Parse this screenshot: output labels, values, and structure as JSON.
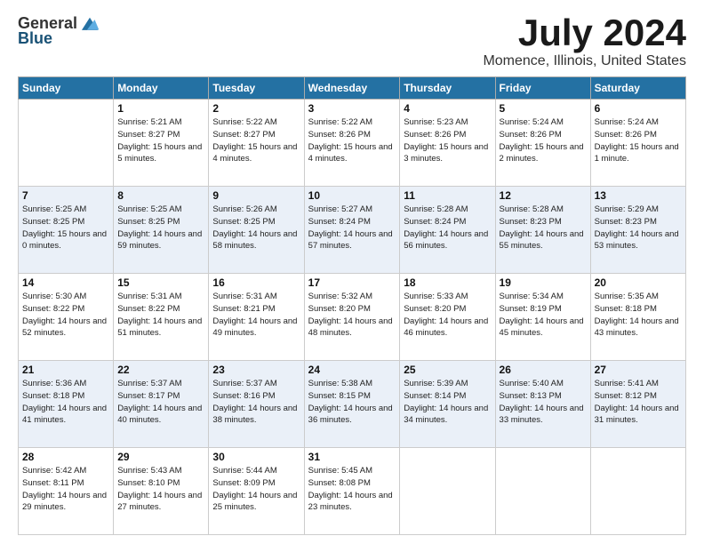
{
  "logo": {
    "general": "General",
    "blue": "Blue"
  },
  "title": "July 2024",
  "location": "Momence, Illinois, United States",
  "headers": [
    "Sunday",
    "Monday",
    "Tuesday",
    "Wednesday",
    "Thursday",
    "Friday",
    "Saturday"
  ],
  "weeks": [
    [
      {
        "day": "",
        "sunrise": "",
        "sunset": "",
        "daylight": ""
      },
      {
        "day": "1",
        "sunrise": "Sunrise: 5:21 AM",
        "sunset": "Sunset: 8:27 PM",
        "daylight": "Daylight: 15 hours and 5 minutes."
      },
      {
        "day": "2",
        "sunrise": "Sunrise: 5:22 AM",
        "sunset": "Sunset: 8:27 PM",
        "daylight": "Daylight: 15 hours and 4 minutes."
      },
      {
        "day": "3",
        "sunrise": "Sunrise: 5:22 AM",
        "sunset": "Sunset: 8:26 PM",
        "daylight": "Daylight: 15 hours and 4 minutes."
      },
      {
        "day": "4",
        "sunrise": "Sunrise: 5:23 AM",
        "sunset": "Sunset: 8:26 PM",
        "daylight": "Daylight: 15 hours and 3 minutes."
      },
      {
        "day": "5",
        "sunrise": "Sunrise: 5:24 AM",
        "sunset": "Sunset: 8:26 PM",
        "daylight": "Daylight: 15 hours and 2 minutes."
      },
      {
        "day": "6",
        "sunrise": "Sunrise: 5:24 AM",
        "sunset": "Sunset: 8:26 PM",
        "daylight": "Daylight: 15 hours and 1 minute."
      }
    ],
    [
      {
        "day": "7",
        "sunrise": "Sunrise: 5:25 AM",
        "sunset": "Sunset: 8:25 PM",
        "daylight": "Daylight: 15 hours and 0 minutes."
      },
      {
        "day": "8",
        "sunrise": "Sunrise: 5:25 AM",
        "sunset": "Sunset: 8:25 PM",
        "daylight": "Daylight: 14 hours and 59 minutes."
      },
      {
        "day": "9",
        "sunrise": "Sunrise: 5:26 AM",
        "sunset": "Sunset: 8:25 PM",
        "daylight": "Daylight: 14 hours and 58 minutes."
      },
      {
        "day": "10",
        "sunrise": "Sunrise: 5:27 AM",
        "sunset": "Sunset: 8:24 PM",
        "daylight": "Daylight: 14 hours and 57 minutes."
      },
      {
        "day": "11",
        "sunrise": "Sunrise: 5:28 AM",
        "sunset": "Sunset: 8:24 PM",
        "daylight": "Daylight: 14 hours and 56 minutes."
      },
      {
        "day": "12",
        "sunrise": "Sunrise: 5:28 AM",
        "sunset": "Sunset: 8:23 PM",
        "daylight": "Daylight: 14 hours and 55 minutes."
      },
      {
        "day": "13",
        "sunrise": "Sunrise: 5:29 AM",
        "sunset": "Sunset: 8:23 PM",
        "daylight": "Daylight: 14 hours and 53 minutes."
      }
    ],
    [
      {
        "day": "14",
        "sunrise": "Sunrise: 5:30 AM",
        "sunset": "Sunset: 8:22 PM",
        "daylight": "Daylight: 14 hours and 52 minutes."
      },
      {
        "day": "15",
        "sunrise": "Sunrise: 5:31 AM",
        "sunset": "Sunset: 8:22 PM",
        "daylight": "Daylight: 14 hours and 51 minutes."
      },
      {
        "day": "16",
        "sunrise": "Sunrise: 5:31 AM",
        "sunset": "Sunset: 8:21 PM",
        "daylight": "Daylight: 14 hours and 49 minutes."
      },
      {
        "day": "17",
        "sunrise": "Sunrise: 5:32 AM",
        "sunset": "Sunset: 8:20 PM",
        "daylight": "Daylight: 14 hours and 48 minutes."
      },
      {
        "day": "18",
        "sunrise": "Sunrise: 5:33 AM",
        "sunset": "Sunset: 8:20 PM",
        "daylight": "Daylight: 14 hours and 46 minutes."
      },
      {
        "day": "19",
        "sunrise": "Sunrise: 5:34 AM",
        "sunset": "Sunset: 8:19 PM",
        "daylight": "Daylight: 14 hours and 45 minutes."
      },
      {
        "day": "20",
        "sunrise": "Sunrise: 5:35 AM",
        "sunset": "Sunset: 8:18 PM",
        "daylight": "Daylight: 14 hours and 43 minutes."
      }
    ],
    [
      {
        "day": "21",
        "sunrise": "Sunrise: 5:36 AM",
        "sunset": "Sunset: 8:18 PM",
        "daylight": "Daylight: 14 hours and 41 minutes."
      },
      {
        "day": "22",
        "sunrise": "Sunrise: 5:37 AM",
        "sunset": "Sunset: 8:17 PM",
        "daylight": "Daylight: 14 hours and 40 minutes."
      },
      {
        "day": "23",
        "sunrise": "Sunrise: 5:37 AM",
        "sunset": "Sunset: 8:16 PM",
        "daylight": "Daylight: 14 hours and 38 minutes."
      },
      {
        "day": "24",
        "sunrise": "Sunrise: 5:38 AM",
        "sunset": "Sunset: 8:15 PM",
        "daylight": "Daylight: 14 hours and 36 minutes."
      },
      {
        "day": "25",
        "sunrise": "Sunrise: 5:39 AM",
        "sunset": "Sunset: 8:14 PM",
        "daylight": "Daylight: 14 hours and 34 minutes."
      },
      {
        "day": "26",
        "sunrise": "Sunrise: 5:40 AM",
        "sunset": "Sunset: 8:13 PM",
        "daylight": "Daylight: 14 hours and 33 minutes."
      },
      {
        "day": "27",
        "sunrise": "Sunrise: 5:41 AM",
        "sunset": "Sunset: 8:12 PM",
        "daylight": "Daylight: 14 hours and 31 minutes."
      }
    ],
    [
      {
        "day": "28",
        "sunrise": "Sunrise: 5:42 AM",
        "sunset": "Sunset: 8:11 PM",
        "daylight": "Daylight: 14 hours and 29 minutes."
      },
      {
        "day": "29",
        "sunrise": "Sunrise: 5:43 AM",
        "sunset": "Sunset: 8:10 PM",
        "daylight": "Daylight: 14 hours and 27 minutes."
      },
      {
        "day": "30",
        "sunrise": "Sunrise: 5:44 AM",
        "sunset": "Sunset: 8:09 PM",
        "daylight": "Daylight: 14 hours and 25 minutes."
      },
      {
        "day": "31",
        "sunrise": "Sunrise: 5:45 AM",
        "sunset": "Sunset: 8:08 PM",
        "daylight": "Daylight: 14 hours and 23 minutes."
      },
      {
        "day": "",
        "sunrise": "",
        "sunset": "",
        "daylight": ""
      },
      {
        "day": "",
        "sunrise": "",
        "sunset": "",
        "daylight": ""
      },
      {
        "day": "",
        "sunrise": "",
        "sunset": "",
        "daylight": ""
      }
    ]
  ]
}
